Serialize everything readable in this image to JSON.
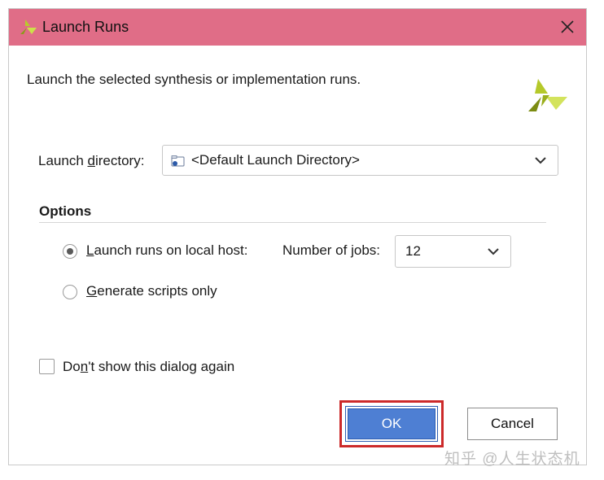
{
  "window": {
    "title": "Launch Runs",
    "titlebar_color": "#e06d87"
  },
  "dialog": {
    "description": "Launch the selected synthesis or implementation runs.",
    "launch_directory": {
      "label_prefix": "Launch ",
      "label_mnemonic": "d",
      "label_suffix": "irectory:",
      "value": "<Default Launch Directory>"
    },
    "options": {
      "heading": "Options",
      "local_host": {
        "mnemonic": "L",
        "label_rest": "aunch runs on local host:",
        "selected": true
      },
      "jobs": {
        "label_prefix": "Number of ",
        "label_mnemonic": "j",
        "label_suffix": "obs:",
        "value": "12"
      },
      "scripts_only": {
        "mnemonic": "G",
        "label_rest": "enerate scripts only",
        "selected": false
      }
    },
    "dont_show": {
      "label_prefix": "Do",
      "label_mnemonic": "n",
      "label_suffix": "'t show this dialog again",
      "checked": false
    },
    "buttons": {
      "ok": "OK",
      "cancel": "Cancel"
    }
  },
  "watermark": "知乎 @人生状态机",
  "colors": {
    "ok_button": "#4e7fd3",
    "highlight": "#cc2a2a",
    "logo_dark": "#8a9a1a",
    "logo_light": "#cde04a"
  },
  "icons": {
    "title": "xilinx-logo-icon",
    "close": "close-icon",
    "folder": "folder-icon",
    "dropdown": "chevron-down-icon"
  }
}
